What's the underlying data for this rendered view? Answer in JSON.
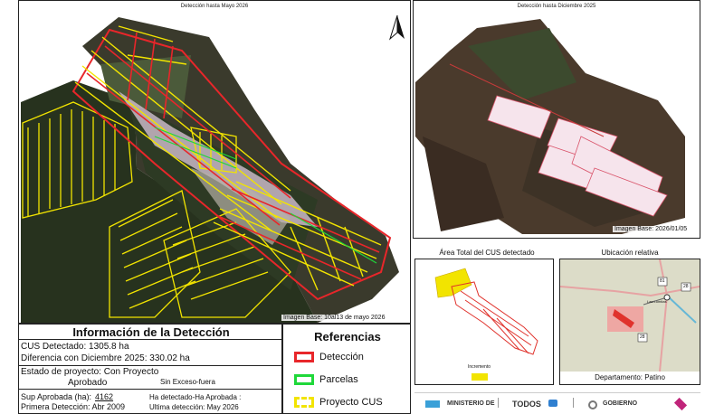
{
  "map_main": {
    "title": "Detección hasta Mayo 2026",
    "caption": "Imagen Base: 10al13 de mayo 2026"
  },
  "map_dec": {
    "title": "Detección hasta Diciembre 2025",
    "caption": "Imagen Base: 2026/01/05"
  },
  "map_area": {
    "title": "Área Total del CUS detectado",
    "legend_label": "Incremento",
    "colors": {
      "fill": "#f2e400",
      "outline": "#e0322c"
    }
  },
  "map_loc": {
    "title": "Ubicación relativa",
    "footer": "Departamento: Patino",
    "place": "Las Lomitas",
    "road_labels": [
      "81",
      "28",
      "28"
    ]
  },
  "info": {
    "heading": "Información de la Detección",
    "cus": "CUS Detectado: 1305.8 ha",
    "diff": "Diferencia con Diciembre 2025: 330.02 ha",
    "estado_l1": "Estado de proyecto: Con Proyecto",
    "estado_l2": "Aprobado",
    "exceso": "Sin Exceso-fuera",
    "sup_label": "Sup Aprobada (ha):",
    "sup_value": "4162",
    "ha_detectado": "Ha detectado-Ha Aprobada :",
    "primera": "Primera Detección: Abr 2009",
    "ultima": "Ultima detección: May 2026"
  },
  "refs": {
    "heading": "Referencias",
    "items": [
      {
        "label": "Detección",
        "color": "#e8262a"
      },
      {
        "label": "Parcelas",
        "color": "#1fd83a"
      },
      {
        "label": "Proyecto CUS",
        "color": "#f2e400"
      }
    ]
  },
  "logos": {
    "ministerio": "MINISTERIO DE",
    "todos": "TODOS",
    "gobierno": "GOBIERNO"
  },
  "icons": {
    "north": "north-arrow-icon"
  }
}
